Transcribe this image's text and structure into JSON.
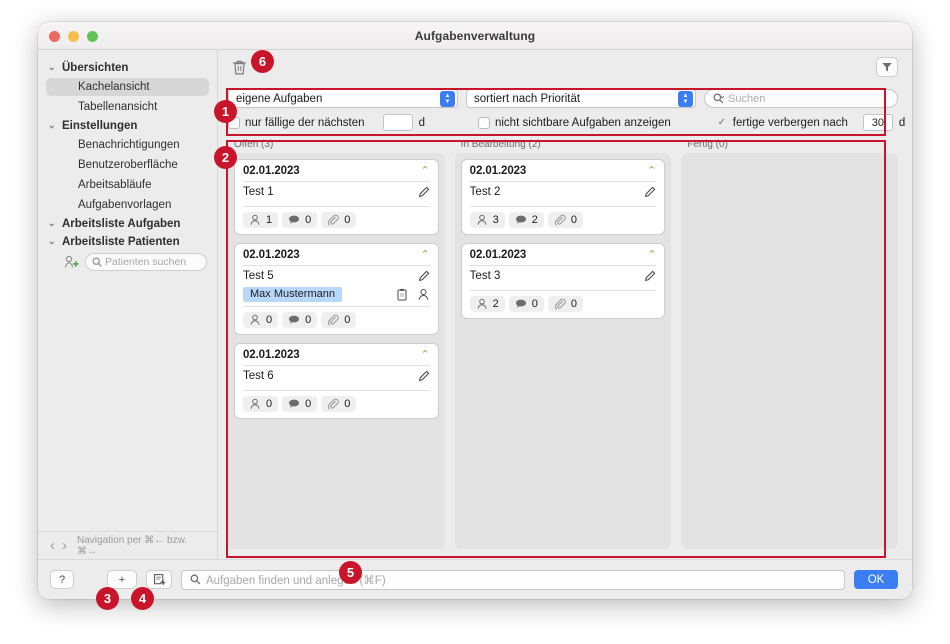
{
  "window": {
    "title": "Aufgabenverwaltung"
  },
  "sidebar": {
    "groups": [
      {
        "label": "Übersichten",
        "items": [
          {
            "label": "Kachelansicht",
            "selected": true
          },
          {
            "label": "Tabellenansicht",
            "selected": false
          }
        ]
      },
      {
        "label": "Einstellungen",
        "items": [
          {
            "label": "Benachrichtigungen",
            "selected": false
          },
          {
            "label": "Benutzeroberfläche",
            "selected": false
          },
          {
            "label": "Arbeitsabläufe",
            "selected": false
          },
          {
            "label": "Aufgabenvorlagen",
            "selected": false
          }
        ]
      },
      {
        "label": "Arbeitsliste Aufgaben",
        "items": []
      },
      {
        "label": "Arbeitsliste Patienten",
        "items": []
      }
    ],
    "patient_search_placeholder": "Patienten suchen",
    "nav_hint": "Navigation per ⌘← bzw. ⌘→"
  },
  "toolbar": {
    "delete_icon": "trash-icon",
    "filter_icon": "funnel-icon"
  },
  "filters": {
    "scope_select": "eigene Aufgaben",
    "sort_select": "sortiert nach Priorität",
    "search_placeholder": "Suchen",
    "due_checkbox_label": "nur fällige der nächsten",
    "due_value": "",
    "due_unit": "d",
    "due_checked": false,
    "invisible_checkbox_label": "nicht sichtbare Aufgaben anzeigen",
    "invisible_checked": false,
    "hide_done_label": "fertige verbergen nach",
    "hide_done_value": "30",
    "hide_done_unit": "d",
    "hide_done_checked": true
  },
  "board": {
    "columns": [
      {
        "header": "Offen (3)",
        "cards": [
          {
            "date": "02.01.2023",
            "title": "Test 1",
            "patient": null,
            "people": "1",
            "comments": "0",
            "attachments": "0"
          },
          {
            "date": "02.01.2023",
            "title": "Test 5",
            "patient": "Max Mustermann",
            "people": "0",
            "comments": "0",
            "attachments": "0"
          },
          {
            "date": "02.01.2023",
            "title": "Test 6",
            "patient": null,
            "people": "0",
            "comments": "0",
            "attachments": "0"
          }
        ]
      },
      {
        "header": "In Bearbeitung (2)",
        "cards": [
          {
            "date": "02.01.2023",
            "title": "Test 2",
            "patient": null,
            "people": "3",
            "comments": "2",
            "attachments": "0"
          },
          {
            "date": "02.01.2023",
            "title": "Test 3",
            "patient": null,
            "people": "2",
            "comments": "0",
            "attachments": "0"
          }
        ]
      },
      {
        "header": "Fertig (0)",
        "cards": []
      }
    ]
  },
  "bottom": {
    "help_label": "?",
    "add_label": "+",
    "template_icon": "note-add-icon",
    "search_placeholder": "Aufgaben finden und anlegen (⌘F)",
    "ok_label": "OK"
  },
  "annotations": {
    "markers": [
      {
        "n": "1"
      },
      {
        "n": "2"
      },
      {
        "n": "3"
      },
      {
        "n": "4"
      },
      {
        "n": "5"
      },
      {
        "n": "6"
      }
    ],
    "color": "#c8152b"
  }
}
